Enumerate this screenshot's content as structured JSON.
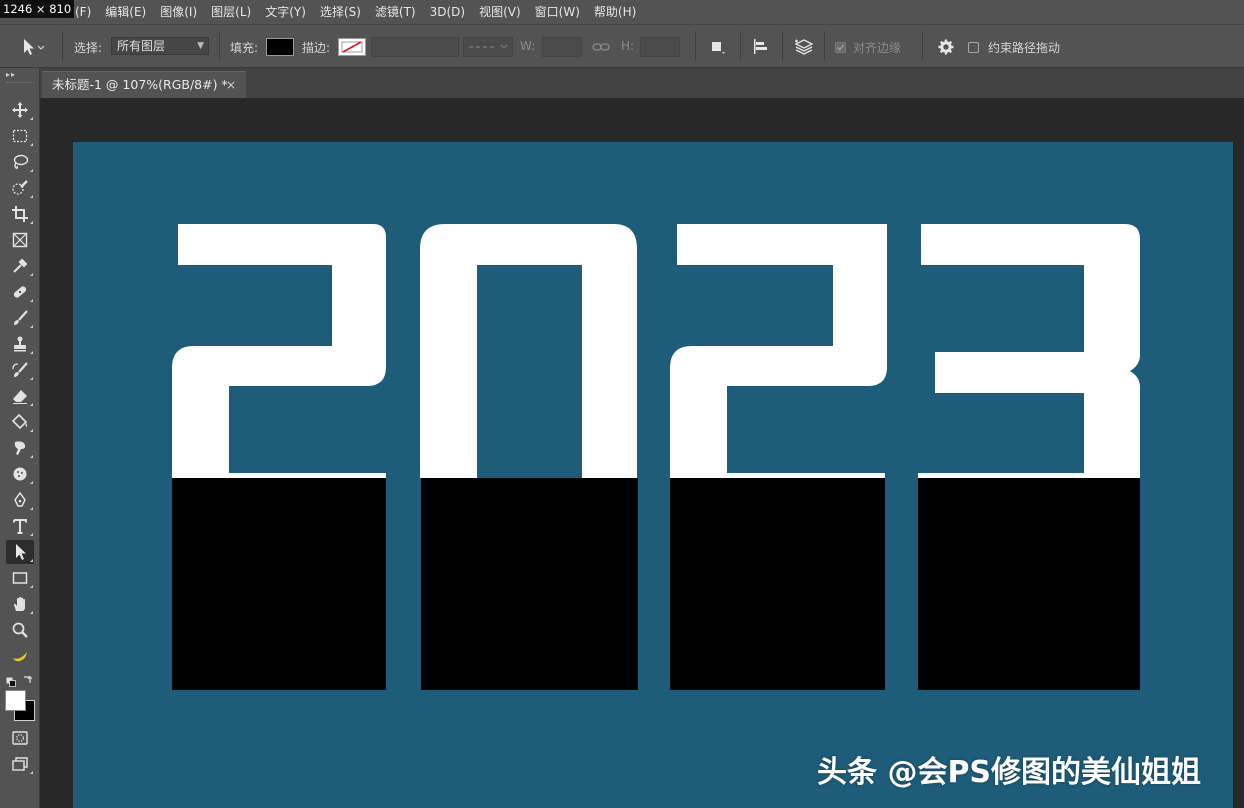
{
  "size_badge": "1246 × 810",
  "menu": [
    "文件(F)",
    "编辑(E)",
    "图像(I)",
    "图层(L)",
    "文字(Y)",
    "选择(S)",
    "滤镜(T)",
    "3D(D)",
    "视图(V)",
    "窗口(W)",
    "帮助(H)"
  ],
  "options": {
    "select_label": "选择:",
    "select_value": "所有图层",
    "fill_label": "填充:",
    "stroke_label": "描边:",
    "w_label": "W:",
    "h_label": "H:",
    "align_edges_label": "对齐边缘",
    "constrain_label": "约束路径拖动",
    "fill_color": "#000000"
  },
  "tab": {
    "title": "未标题-1 @ 107%(RGB/8#) *",
    "close": "×"
  },
  "canvas": {
    "background": "#1e5d7a",
    "text": "2023",
    "text_color": "#ffffff",
    "block_color": "#000000"
  },
  "watermark": "头条 @会PS修图的美仙姐姐",
  "tools": [
    "move-tool",
    "marquee-tool",
    "lasso-tool",
    "quick-select-tool",
    "crop-tool",
    "frame-tool",
    "eyedropper-tool",
    "healing-brush-tool",
    "brush-tool",
    "clone-stamp-tool",
    "history-brush-tool",
    "eraser-tool",
    "paint-bucket-tool",
    "smudge-tool",
    "dodge-tool",
    "pen-tool",
    "type-tool",
    "path-selection-tool",
    "rectangle-tool",
    "hand-tool",
    "zoom-tool",
    "banana-tool"
  ]
}
